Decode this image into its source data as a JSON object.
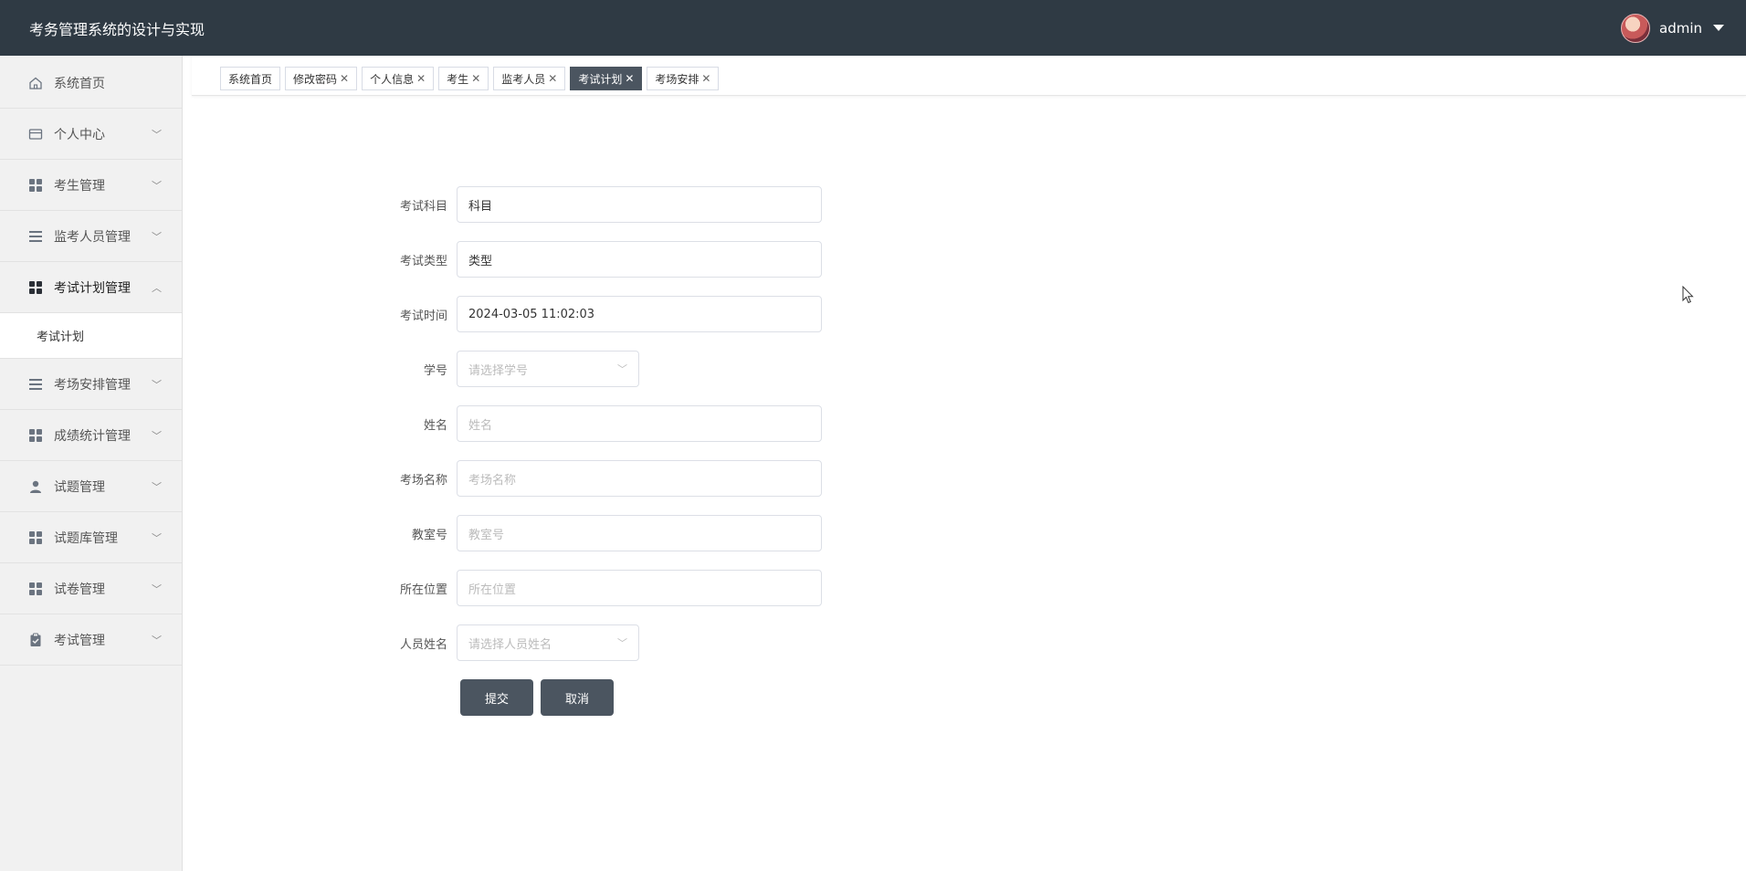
{
  "header": {
    "title": "考务管理系统的设计与实现",
    "username": "admin"
  },
  "sidebar": {
    "items": [
      {
        "label": "系统首页",
        "icon": "home-icon"
      },
      {
        "label": "个人中心",
        "icon": "wallet-icon"
      },
      {
        "label": "考生管理",
        "icon": "grid-icon"
      },
      {
        "label": "监考人员管理",
        "icon": "list-icon"
      },
      {
        "label": "考试计划管理",
        "icon": "grid-icon",
        "open": true,
        "sub": "考试计划"
      },
      {
        "label": "考场安排管理",
        "icon": "list-icon"
      },
      {
        "label": "成绩统计管理",
        "icon": "grid-icon"
      },
      {
        "label": "试题管理",
        "icon": "user-icon"
      },
      {
        "label": "试题库管理",
        "icon": "grid-icon"
      },
      {
        "label": "试卷管理",
        "icon": "grid-icon"
      },
      {
        "label": "考试管理",
        "icon": "clipboard-icon"
      }
    ]
  },
  "tabs": [
    {
      "label": "系统首页",
      "closable": false
    },
    {
      "label": "修改密码",
      "closable": true
    },
    {
      "label": "个人信息",
      "closable": true
    },
    {
      "label": "考生",
      "closable": true
    },
    {
      "label": "监考人员",
      "closable": true
    },
    {
      "label": "考试计划",
      "closable": true,
      "active": true
    },
    {
      "label": "考场安排",
      "closable": true
    }
  ],
  "form": {
    "subject": {
      "label": "考试科目",
      "value": "科目"
    },
    "type": {
      "label": "考试类型",
      "value": "类型"
    },
    "time": {
      "label": "考试时间",
      "value": "2024-03-05 11:02:03"
    },
    "student_no": {
      "label": "学号",
      "placeholder": "请选择学号"
    },
    "name": {
      "label": "姓名",
      "placeholder": "姓名"
    },
    "room_name": {
      "label": "考场名称",
      "placeholder": "考场名称"
    },
    "classroom": {
      "label": "教室号",
      "placeholder": "教室号"
    },
    "location": {
      "label": "所在位置",
      "placeholder": "所在位置"
    },
    "staff_name": {
      "label": "人员姓名",
      "placeholder": "请选择人员姓名"
    },
    "submit_label": "提交",
    "cancel_label": "取消"
  },
  "colors": {
    "header_bg": "#2f3a44",
    "sidebar_bg": "#f1f1f1",
    "button_bg": "#4b5560",
    "active_tab_bg": "#4b5560"
  }
}
